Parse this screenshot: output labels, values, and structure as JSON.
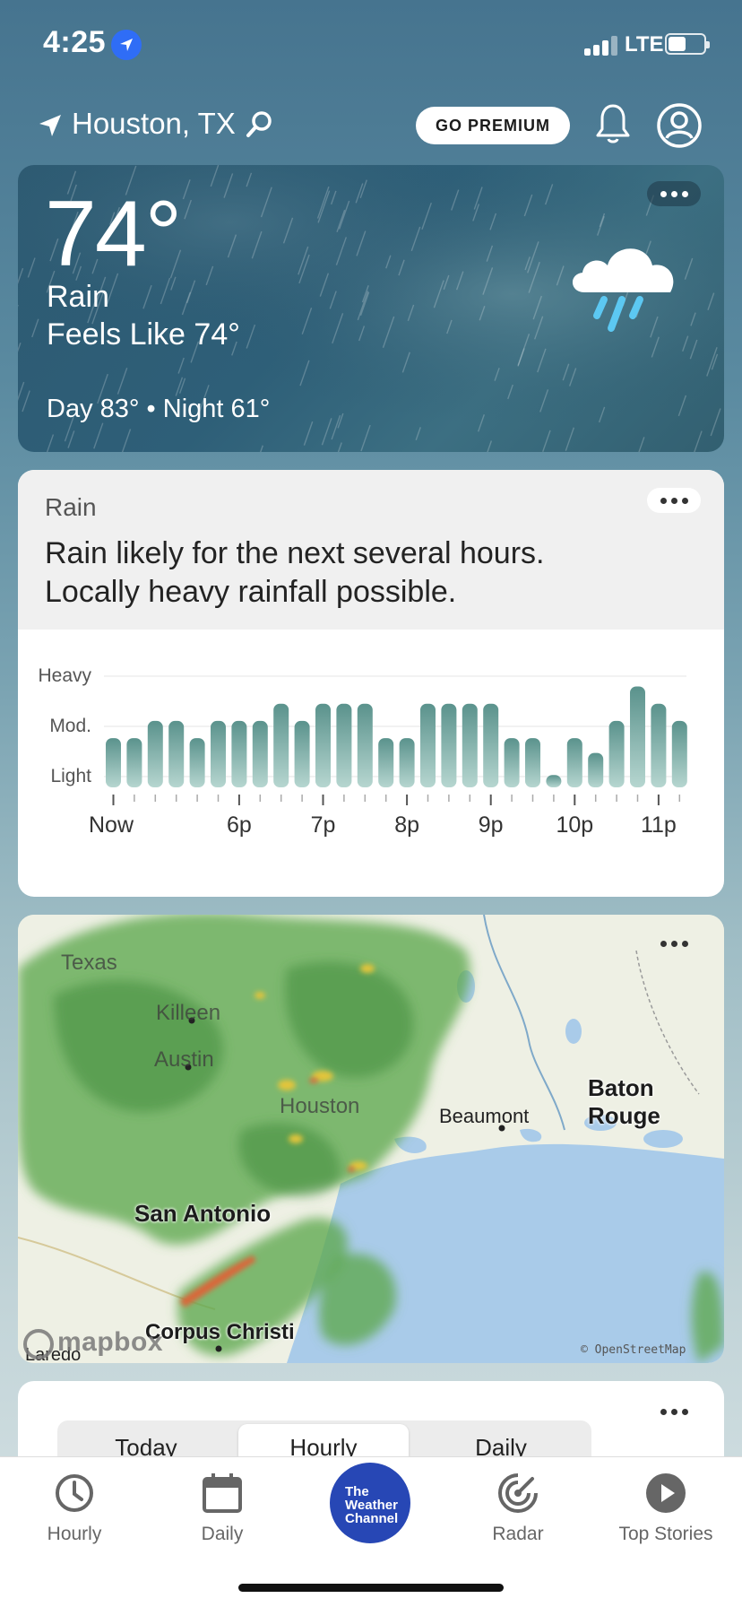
{
  "status_bar": {
    "time": "4:25",
    "network": "LTE",
    "battery_level": 0.45
  },
  "header": {
    "location": "Houston, TX",
    "premium_label": "GO PREMIUM"
  },
  "current": {
    "temperature": "74°",
    "condition": "Rain",
    "feels_like": "Feels Like 74°",
    "day_night": "Day 83° • Night 61°",
    "icon": "rain-cloud-icon"
  },
  "rain_card": {
    "label": "Rain",
    "summary_line1": "Rain likely for the next several hours.",
    "summary_line2": "Locally heavy rainfall possible."
  },
  "chart_data": {
    "type": "bar",
    "title": "",
    "y_levels": [
      "Heavy",
      "Mod.",
      "Light"
    ],
    "x_tick_labels": [
      "Now",
      "6p",
      "7p",
      "8p",
      "9p",
      "10p",
      "11p"
    ],
    "x_tick_positions": [
      0,
      6,
      10,
      14,
      18,
      22,
      26
    ],
    "values": [
      1.0,
      1.0,
      1.35,
      1.35,
      1.0,
      1.35,
      1.35,
      1.35,
      1.7,
      1.35,
      1.7,
      1.7,
      1.7,
      1.0,
      1.0,
      1.7,
      1.7,
      1.7,
      1.7,
      1.0,
      1.0,
      0.25,
      1.0,
      0.7,
      1.35,
      2.05,
      1.7,
      1.35
    ],
    "value_scale": "0 = none, 1 = Light, 2 = Mod., 3 = Heavy",
    "ylim": [
      0,
      3
    ],
    "bar_color": "#5f9892"
  },
  "map": {
    "labels": [
      "Killeen",
      "Austin",
      "Houston",
      "Beaumont",
      "Baton Rouge",
      "San Antonio",
      "Corpus Christi",
      "Laredo",
      "Texas"
    ],
    "provider": "mapbox",
    "attribution": "© OpenStreetMap"
  },
  "forecast_tabs": {
    "today": "Today",
    "hourly": "Hourly",
    "daily": "Daily",
    "selected": "Hourly"
  },
  "tabbar": {
    "hourly": "Hourly",
    "daily": "Daily",
    "logo_line1": "The",
    "logo_line2": "Weather",
    "logo_line3": "Channel",
    "radar": "Radar",
    "top_stories": "Top Stories"
  }
}
